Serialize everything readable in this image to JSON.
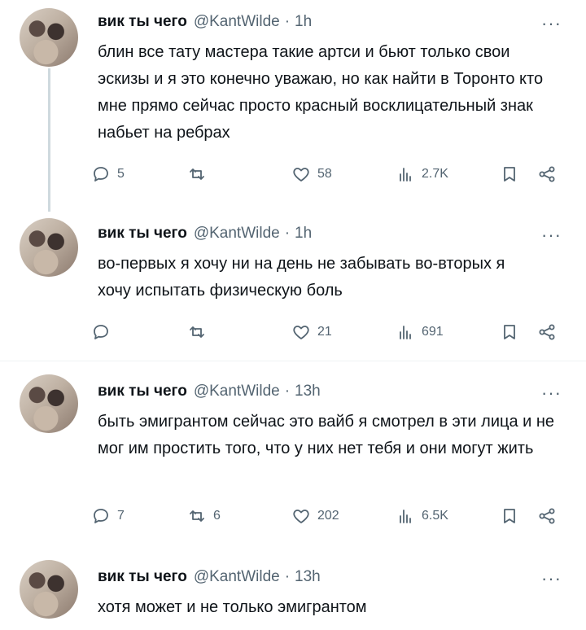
{
  "tweets": [
    {
      "name": "вик ты чего",
      "handle": "@KantWilde",
      "time": "1h",
      "more": "···",
      "text": "блин все тату мастера такие артси и бьют только свои эскизы и я это конечно уважаю, но как найти в Торонто кто мне прямо сейчас просто красный восклицательный знак набьет на ребрах",
      "replies": "5",
      "retweets": "",
      "likes": "58",
      "views": "2.7K"
    },
    {
      "name": "вик ты чего",
      "handle": "@KantWilde",
      "time": "1h",
      "more": "···",
      "text": "во-первых я хочу ни на день не забывать во-вторых я хочу испытать физическую боль",
      "replies": "",
      "retweets": "",
      "likes": "21",
      "views": "691"
    },
    {
      "name": "вик ты чего",
      "handle": "@KantWilde",
      "time": "13h",
      "more": "···",
      "text": "быть эмигрантом сейчас это вайб я смотрел в эти лица и не мог им простить того, что у них нет тебя и они могут жить",
      "replies": "7",
      "retweets": "6",
      "likes": "202",
      "views": "6.5K"
    },
    {
      "name": "вик ты чего",
      "handle": "@KantWilde",
      "time": "13h",
      "more": "···",
      "text": "хотя может и не только эмигрантом"
    }
  ],
  "separator": "·",
  "icons": [
    "reply-icon",
    "retweet-icon",
    "like-icon",
    "views-icon",
    "bookmark-icon",
    "share-icon"
  ]
}
